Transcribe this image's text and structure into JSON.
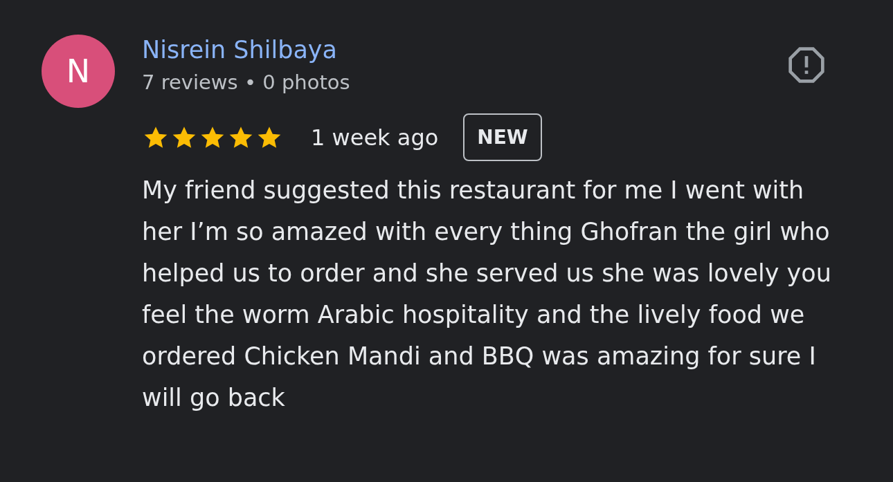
{
  "review": {
    "avatar_letter": "N",
    "author": "Nisrein Shilbaya",
    "author_stats": "7 reviews • 0 photos",
    "stars": 5,
    "time": "1 week ago",
    "badge": "NEW",
    "text": "My friend suggested this restaurant for me I went with her I’m so amazed with every thing Ghofran the girl who helped us to order and she served us she was lovely you feel the worm Arabic hospitality and the lively food we ordered Chicken Mandi and BBQ was amazing for sure I will go back"
  }
}
